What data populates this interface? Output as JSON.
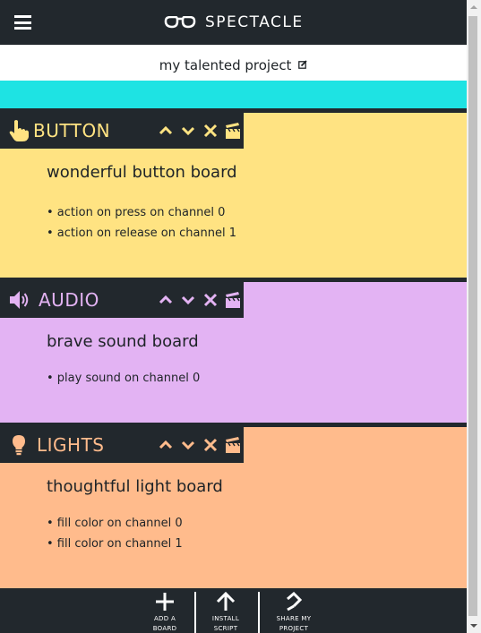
{
  "app": {
    "name": "SPECTACLE"
  },
  "header": {
    "menu_icon": "hamburger-icon",
    "logo_icon": "spectacles-logo"
  },
  "project": {
    "title": "my talented project",
    "edit_icon": "edit-icon"
  },
  "colors": {
    "header_bg": "#22282d",
    "cyan_board": "#1ee3e3",
    "button_board": "#ffe382",
    "audio_board": "#e3b3f3",
    "lights_board": "#ffbb8c"
  },
  "boards": [
    {
      "type": "BUTTON",
      "icon": "pointing-hand-icon",
      "name": "wonderful button board",
      "actions": [
        "• action on press on channel 0",
        "• action on release on channel 1"
      ]
    },
    {
      "type": "AUDIO",
      "icon": "speaker-icon",
      "name": "brave sound board",
      "actions": [
        "• play sound on channel 0"
      ]
    },
    {
      "type": "LIGHTS",
      "icon": "lightbulb-icon",
      "name": "thoughtful light board",
      "actions": [
        "• fill color on channel 0",
        "• fill color on channel 1"
      ]
    }
  ],
  "board_controls": [
    "move-up-icon",
    "move-down-icon",
    "delete-icon",
    "clapperboard-icon"
  ],
  "footer": {
    "add_board": {
      "line1": "ADD A",
      "line2": "BOARD",
      "icon": "plus-icon"
    },
    "install_script": {
      "line1": "INSTALL",
      "line2": "SCRIPT",
      "icon": "arrow-up-icon"
    },
    "share_project": {
      "line1": "SHARE MY",
      "line2": "PROJECT",
      "icon": "share-icon"
    }
  }
}
